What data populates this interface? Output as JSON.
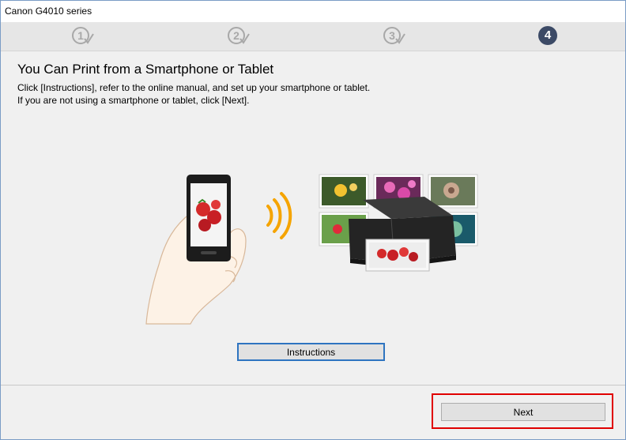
{
  "window": {
    "title": "Canon G4010 series"
  },
  "steps": [
    {
      "number": "1",
      "state": "done"
    },
    {
      "number": "2",
      "state": "done"
    },
    {
      "number": "3",
      "state": "done"
    },
    {
      "number": "4",
      "state": "current"
    }
  ],
  "main": {
    "heading": "You Can Print from a Smartphone or Tablet",
    "line1": "Click [Instructions], refer to the online manual, and set up your smartphone or tablet.",
    "line2": "If you are not using a smartphone or tablet, click [Next]."
  },
  "buttons": {
    "instructions": "Instructions",
    "next": "Next"
  },
  "colors": {
    "step_done": "#a8a8a8",
    "step_current": "#3c4a66",
    "focus_border": "#2e74c0",
    "highlight": "#e00000",
    "wifi": "#f5a400"
  }
}
